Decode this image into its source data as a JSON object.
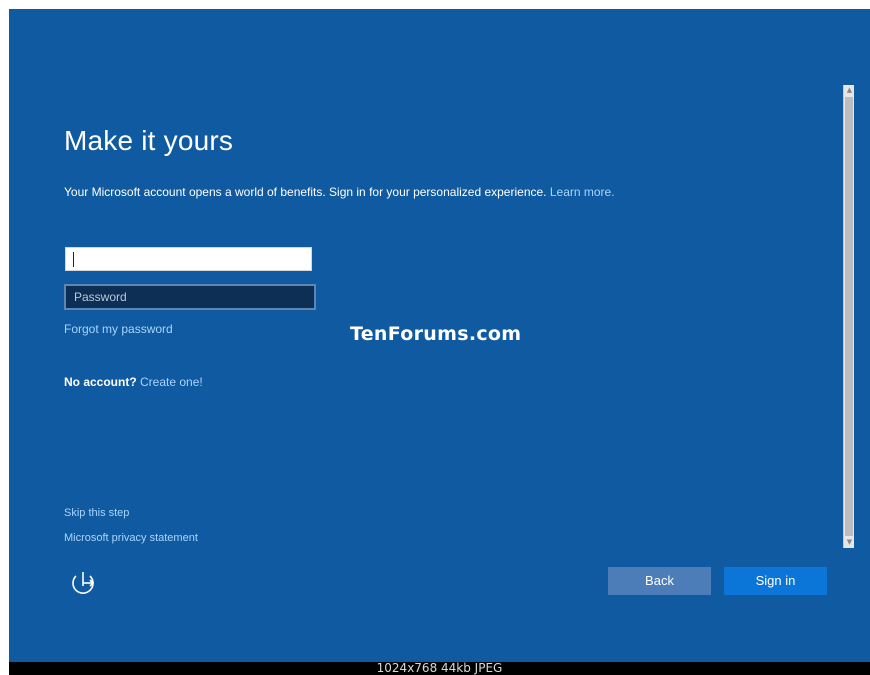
{
  "page": {
    "title": "Make it yours",
    "description_text": "Your Microsoft account opens a world of benefits. Sign in for your personalized experience.",
    "learn_more": "Learn more.",
    "email_value": "",
    "password_placeholder": "Password",
    "forgot_password": "Forgot my password",
    "no_account_question": "No account?",
    "create_one": "Create one!",
    "skip_step": "Skip this step",
    "privacy_statement": "Microsoft privacy statement",
    "watermark": "TenForums.com"
  },
  "buttons": {
    "back": "Back",
    "sign_in": "Sign in"
  },
  "icons": {
    "accessibility": "ease-of-access-icon",
    "scroll_up": "scroll-up-arrow-icon",
    "scroll_down": "scroll-down-arrow-icon"
  },
  "caption": "1024x768 44kb JPEG",
  "colors": {
    "background": "#0f5aa0",
    "link": "#a9d4ff",
    "back_button": "#4c7db8",
    "sign_in_button": "#0b76d7",
    "password_field": "#0d2f55"
  }
}
